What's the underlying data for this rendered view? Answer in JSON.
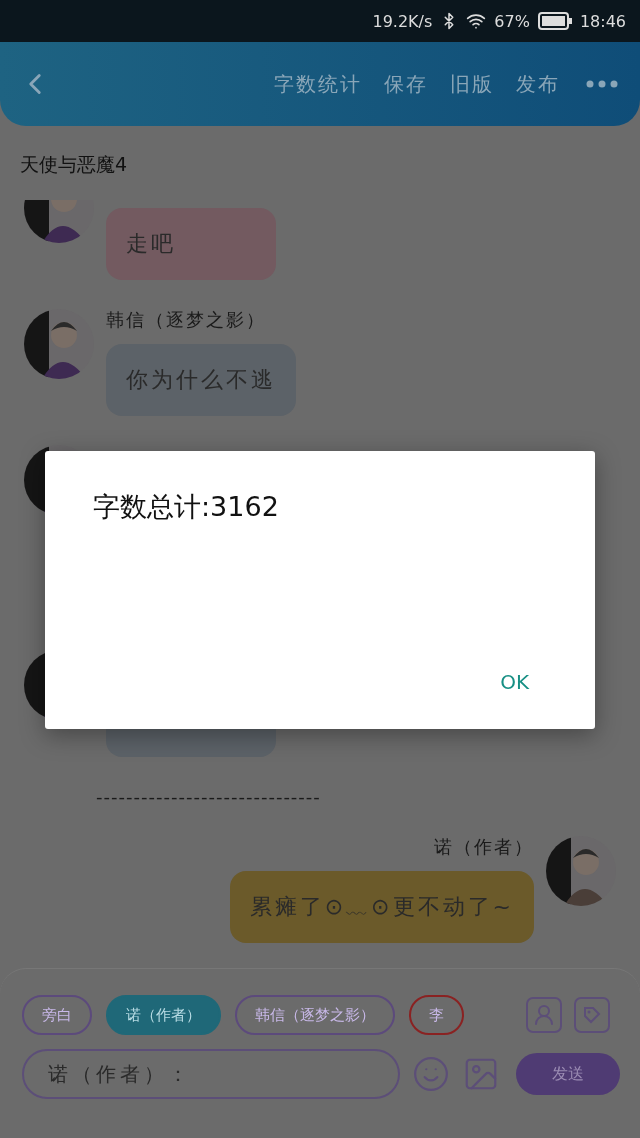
{
  "status_bar": {
    "speed": "19.2K/s",
    "battery": "67%",
    "time": "18:46"
  },
  "header": {
    "actions": [
      "字数统计",
      "保存",
      "旧版",
      "发布"
    ]
  },
  "title": "天使与恶魔4",
  "messages": [
    {
      "kind": "left",
      "text": "走吧",
      "color": "#735a60"
    },
    {
      "kind": "left",
      "name": "韩信（逐梦之影）",
      "text": "你为什么不逃",
      "color": "#5c6268"
    },
    {
      "kind": "covered"
    },
    {
      "kind": "covered",
      "color": "#5c6268"
    },
    {
      "kind": "divider",
      "text": "------------------------------"
    },
    {
      "kind": "right",
      "name": "诺（作者）",
      "text": "累瘫了⊙﹏⊙更不动了~",
      "color": "#6b5a2a"
    }
  ],
  "roles": [
    {
      "label": "旁白",
      "selected": false,
      "color": "#5c4a7c"
    },
    {
      "label": "诺（作者）",
      "selected": true,
      "color": "#1f6878"
    },
    {
      "label": "韩信（逐梦之影）",
      "selected": false,
      "color": "#5c4a7c"
    },
    {
      "label": "李",
      "selected": false,
      "color": "#8a2222"
    }
  ],
  "input": {
    "placeholder": "诺（作者）："
  },
  "send": "发送",
  "dialog": {
    "message": "字数总计:3162",
    "button": "OK"
  }
}
